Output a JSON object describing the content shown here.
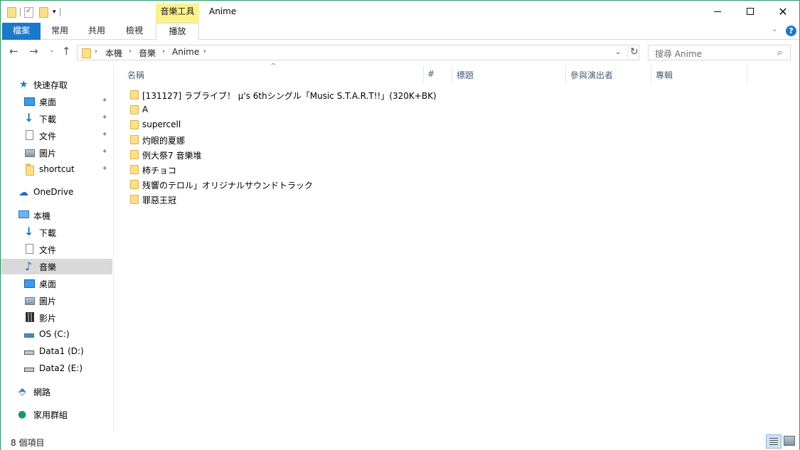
{
  "window": {
    "title": "Anime",
    "context_tab_group": "音樂工具",
    "buttons": {
      "minimize": "—",
      "maximize": "☐",
      "close": "✕"
    }
  },
  "qat": {
    "dropdown": "▾"
  },
  "ribbon": {
    "tabs": [
      {
        "label": "檔案",
        "id": "file"
      },
      {
        "label": "常用",
        "id": "home"
      },
      {
        "label": "共用",
        "id": "share"
      },
      {
        "label": "檢視",
        "id": "view"
      },
      {
        "label": "播放",
        "id": "play"
      }
    ],
    "expand_icon": "⌄",
    "help": "?"
  },
  "nav": {
    "back": "←",
    "forward": "→",
    "recent": "⌄",
    "up": "↑",
    "breadcrumb": [
      "本機",
      "音樂",
      "Anime"
    ],
    "breadcrumb_sep": "›",
    "refresh": "↻",
    "dropdown": "⌄"
  },
  "search": {
    "placeholder": "搜尋 Anime"
  },
  "sidebar": {
    "items": [
      {
        "label": "快速存取",
        "icon": "star-icon",
        "pinned": false
      },
      {
        "label": "桌面",
        "icon": "desktop-icon",
        "pinned": true
      },
      {
        "label": "下載",
        "icon": "download-icon",
        "pinned": true
      },
      {
        "label": "文件",
        "icon": "document-icon",
        "pinned": true
      },
      {
        "label": "圖片",
        "icon": "picture-icon",
        "pinned": true
      },
      {
        "label": "shortcut",
        "icon": "folder-icon",
        "pinned": true
      },
      {
        "label": "OneDrive",
        "icon": "onedrive-icon",
        "pinned": false
      },
      {
        "label": "本機",
        "icon": "this-pc-icon",
        "pinned": false
      },
      {
        "label": "下載",
        "icon": "download-icon",
        "pinned": false
      },
      {
        "label": "文件",
        "icon": "document-icon",
        "pinned": false
      },
      {
        "label": "音樂",
        "icon": "music-icon",
        "pinned": false,
        "selected": true
      },
      {
        "label": "桌面",
        "icon": "desktop-icon",
        "pinned": false
      },
      {
        "label": "圖片",
        "icon": "picture-icon",
        "pinned": false
      },
      {
        "label": "影片",
        "icon": "video-icon",
        "pinned": false
      },
      {
        "label": "OS (C:)",
        "icon": "os-drive-icon",
        "pinned": false
      },
      {
        "label": "Data1 (D:)",
        "icon": "drive-icon",
        "pinned": false
      },
      {
        "label": "Data2 (E:)",
        "icon": "drive-icon",
        "pinned": false
      },
      {
        "label": "網路",
        "icon": "network-icon",
        "pinned": false
      },
      {
        "label": "家用群組",
        "icon": "homegroup-icon",
        "pinned": false
      }
    ],
    "pin_glyph": "📌"
  },
  "columns": {
    "name": "名稱",
    "number": "#",
    "title": "標題",
    "artists": "參與演出者",
    "album": "專輯",
    "sort_arrow": "^"
  },
  "files": [
    "[131127] ラブライブ！ μ's 6thシングル「Music S.T.A.R.T!!」(320K+BK)",
    "A",
    "supercell",
    "灼眼的夏娜",
    "例大祭7 音樂堆",
    "柿チョコ",
    "残響のテロル」オリジナルサウンドトラック",
    "罪惡王冠"
  ],
  "status": {
    "item_count": "8 個項目"
  }
}
